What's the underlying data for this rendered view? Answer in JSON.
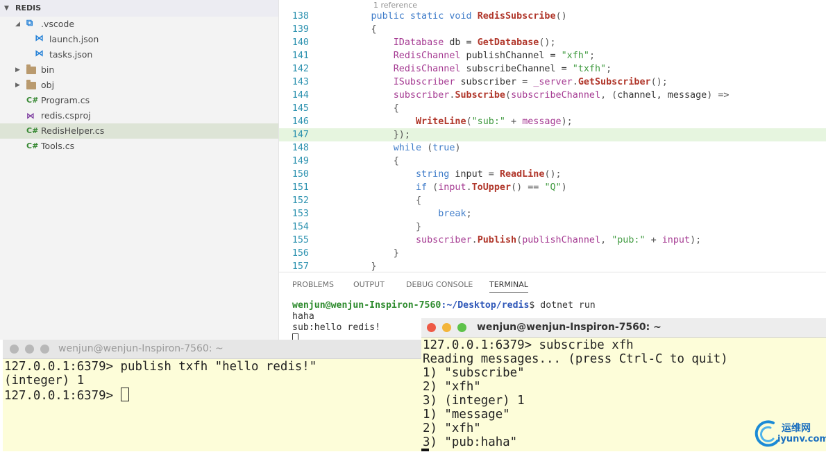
{
  "explorer": {
    "title": "REDIS",
    "items": [
      {
        "label": ".vscode",
        "type": "folder-vscode",
        "depth": 1,
        "expanded": true
      },
      {
        "label": "launch.json",
        "type": "vscode-json",
        "depth": 2
      },
      {
        "label": "tasks.json",
        "type": "vscode-json",
        "depth": 2
      },
      {
        "label": "bin",
        "type": "folder",
        "depth": 1,
        "expanded": false
      },
      {
        "label": "obj",
        "type": "folder",
        "depth": 1,
        "expanded": false
      },
      {
        "label": "Program.cs",
        "type": "csharp",
        "depth": 1
      },
      {
        "label": "redis.csproj",
        "type": "csproj",
        "depth": 1
      },
      {
        "label": "RedisHelper.cs",
        "type": "csharp",
        "depth": 1,
        "selected": true
      },
      {
        "label": "Tools.cs",
        "type": "csharp",
        "depth": 1
      }
    ]
  },
  "editor": {
    "codelens": "1 reference",
    "highlighted_line": "147",
    "lines": [
      {
        "n": "138",
        "tokens": [
          [
            "s",
            "        "
          ],
          [
            "kw",
            "public static void "
          ],
          [
            "fn",
            "RedisSubscribe"
          ],
          [
            "op",
            "()"
          ]
        ]
      },
      {
        "n": "139",
        "tokens": [
          [
            "s",
            "        "
          ],
          [
            "op",
            "{"
          ]
        ]
      },
      {
        "n": "140",
        "tokens": [
          [
            "s",
            "            "
          ],
          [
            "ty",
            "IDatabase"
          ],
          [
            "s",
            " db = "
          ],
          [
            "fn",
            "GetDatabase"
          ],
          [
            "op",
            "();"
          ]
        ]
      },
      {
        "n": "141",
        "tokens": [
          [
            "s",
            "            "
          ],
          [
            "ty",
            "RedisChannel"
          ],
          [
            "s",
            " publishChannel = "
          ],
          [
            "st",
            "\"xfh\""
          ],
          [
            "op",
            ";"
          ]
        ]
      },
      {
        "n": "142",
        "tokens": [
          [
            "s",
            "            "
          ],
          [
            "ty",
            "RedisChannel"
          ],
          [
            "s",
            " subscribeChannel = "
          ],
          [
            "st",
            "\"txfh\""
          ],
          [
            "op",
            ";"
          ]
        ]
      },
      {
        "n": "143",
        "tokens": [
          [
            "s",
            "            "
          ],
          [
            "ty",
            "ISubscriber"
          ],
          [
            "s",
            " subscriber = "
          ],
          [
            "va",
            "_server"
          ],
          [
            "op",
            "."
          ],
          [
            "fn",
            "GetSubscriber"
          ],
          [
            "op",
            "();"
          ]
        ]
      },
      {
        "n": "144",
        "tokens": [
          [
            "s",
            "            "
          ],
          [
            "va",
            "subscriber"
          ],
          [
            "op",
            "."
          ],
          [
            "fn",
            "Subscribe"
          ],
          [
            "op",
            "("
          ],
          [
            "va",
            "subscribeChannel"
          ],
          [
            "op",
            ", ("
          ],
          [
            "s",
            "channel, message"
          ],
          [
            "op",
            ") =>"
          ]
        ]
      },
      {
        "n": "145",
        "tokens": [
          [
            "s",
            "            "
          ],
          [
            "op",
            "{"
          ]
        ]
      },
      {
        "n": "146",
        "tokens": [
          [
            "s",
            "                "
          ],
          [
            "fn",
            "WriteLine"
          ],
          [
            "op",
            "("
          ],
          [
            "st",
            "\"sub:\""
          ],
          [
            "op",
            " + "
          ],
          [
            "va",
            "message"
          ],
          [
            "op",
            ");"
          ]
        ]
      },
      {
        "n": "147",
        "tokens": [
          [
            "s",
            "            "
          ],
          [
            "op",
            "});"
          ]
        ]
      },
      {
        "n": "148",
        "tokens": [
          [
            "s",
            "            "
          ],
          [
            "kw",
            "while"
          ],
          [
            "op",
            " ("
          ],
          [
            "kw",
            "true"
          ],
          [
            "op",
            ")"
          ]
        ]
      },
      {
        "n": "149",
        "tokens": [
          [
            "s",
            "            "
          ],
          [
            "op",
            "{"
          ]
        ]
      },
      {
        "n": "150",
        "tokens": [
          [
            "s",
            "                "
          ],
          [
            "kw",
            "string"
          ],
          [
            "s",
            " input = "
          ],
          [
            "fn",
            "ReadLine"
          ],
          [
            "op",
            "();"
          ]
        ]
      },
      {
        "n": "151",
        "tokens": [
          [
            "s",
            "                "
          ],
          [
            "kw",
            "if"
          ],
          [
            "op",
            " ("
          ],
          [
            "va",
            "input"
          ],
          [
            "op",
            "."
          ],
          [
            "fn",
            "ToUpper"
          ],
          [
            "op",
            "() == "
          ],
          [
            "st",
            "\"Q\""
          ],
          [
            "op",
            ")"
          ]
        ]
      },
      {
        "n": "152",
        "tokens": [
          [
            "s",
            "                "
          ],
          [
            "op",
            "{"
          ]
        ]
      },
      {
        "n": "153",
        "tokens": [
          [
            "s",
            "                    "
          ],
          [
            "kw",
            "break"
          ],
          [
            "op",
            ";"
          ]
        ]
      },
      {
        "n": "154",
        "tokens": [
          [
            "s",
            "                "
          ],
          [
            "op",
            "}"
          ]
        ]
      },
      {
        "n": "155",
        "tokens": [
          [
            "s",
            "                "
          ],
          [
            "va",
            "subscriber"
          ],
          [
            "op",
            "."
          ],
          [
            "fn",
            "Publish"
          ],
          [
            "op",
            "("
          ],
          [
            "va",
            "publishChannel"
          ],
          [
            "op",
            ", "
          ],
          [
            "st",
            "\"pub:\""
          ],
          [
            "op",
            " + "
          ],
          [
            "va",
            "input"
          ],
          [
            "op",
            ");"
          ]
        ]
      },
      {
        "n": "156",
        "tokens": [
          [
            "s",
            "            "
          ],
          [
            "op",
            "}"
          ]
        ]
      },
      {
        "n": "157",
        "tokens": [
          [
            "s",
            "        "
          ],
          [
            "op",
            "}"
          ]
        ]
      }
    ]
  },
  "panel": {
    "tabs": [
      {
        "label": "PROBLEMS",
        "active": false
      },
      {
        "label": "OUTPUT",
        "active": false
      },
      {
        "label": "DEBUG CONSOLE",
        "active": false
      },
      {
        "label": "TERMINAL",
        "active": true
      }
    ],
    "terminal": {
      "user": "wenjun@wenjun-Inspiron-7560",
      "path": ":~/Desktop/redis",
      "command": "$ dotnet run",
      "output": [
        "haha",
        "sub:hello redis!"
      ]
    }
  },
  "left_terminal": {
    "title": "wenjun@wenjun-Inspiron-7560: ~",
    "lines": [
      "127.0.0.1:6379> publish txfh \"hello redis!\"",
      "(integer) 1",
      "127.0.0.1:6379> "
    ]
  },
  "right_terminal": {
    "title": "wenjun@wenjun-Inspiron-7560: ~",
    "lines": [
      "127.0.0.1:6379> subscribe xfh",
      "Reading messages... (press Ctrl-C to quit)",
      "1) \"subscribe\"",
      "2) \"xfh\"",
      "3) (integer) 1",
      "1) \"message\"",
      "2) \"xfh\"",
      "3) \"pub:haha\""
    ]
  },
  "watermark": {
    "cn": "运维网",
    "en": "iyunv.com"
  },
  "colors": {
    "close": "#ee5a46",
    "minimize": "#f3b53a",
    "maximize": "#5ec24a",
    "terminal_bg": "#fdfdd9",
    "selection": "#dde4d6",
    "line_highlight": "#e6f5df"
  }
}
